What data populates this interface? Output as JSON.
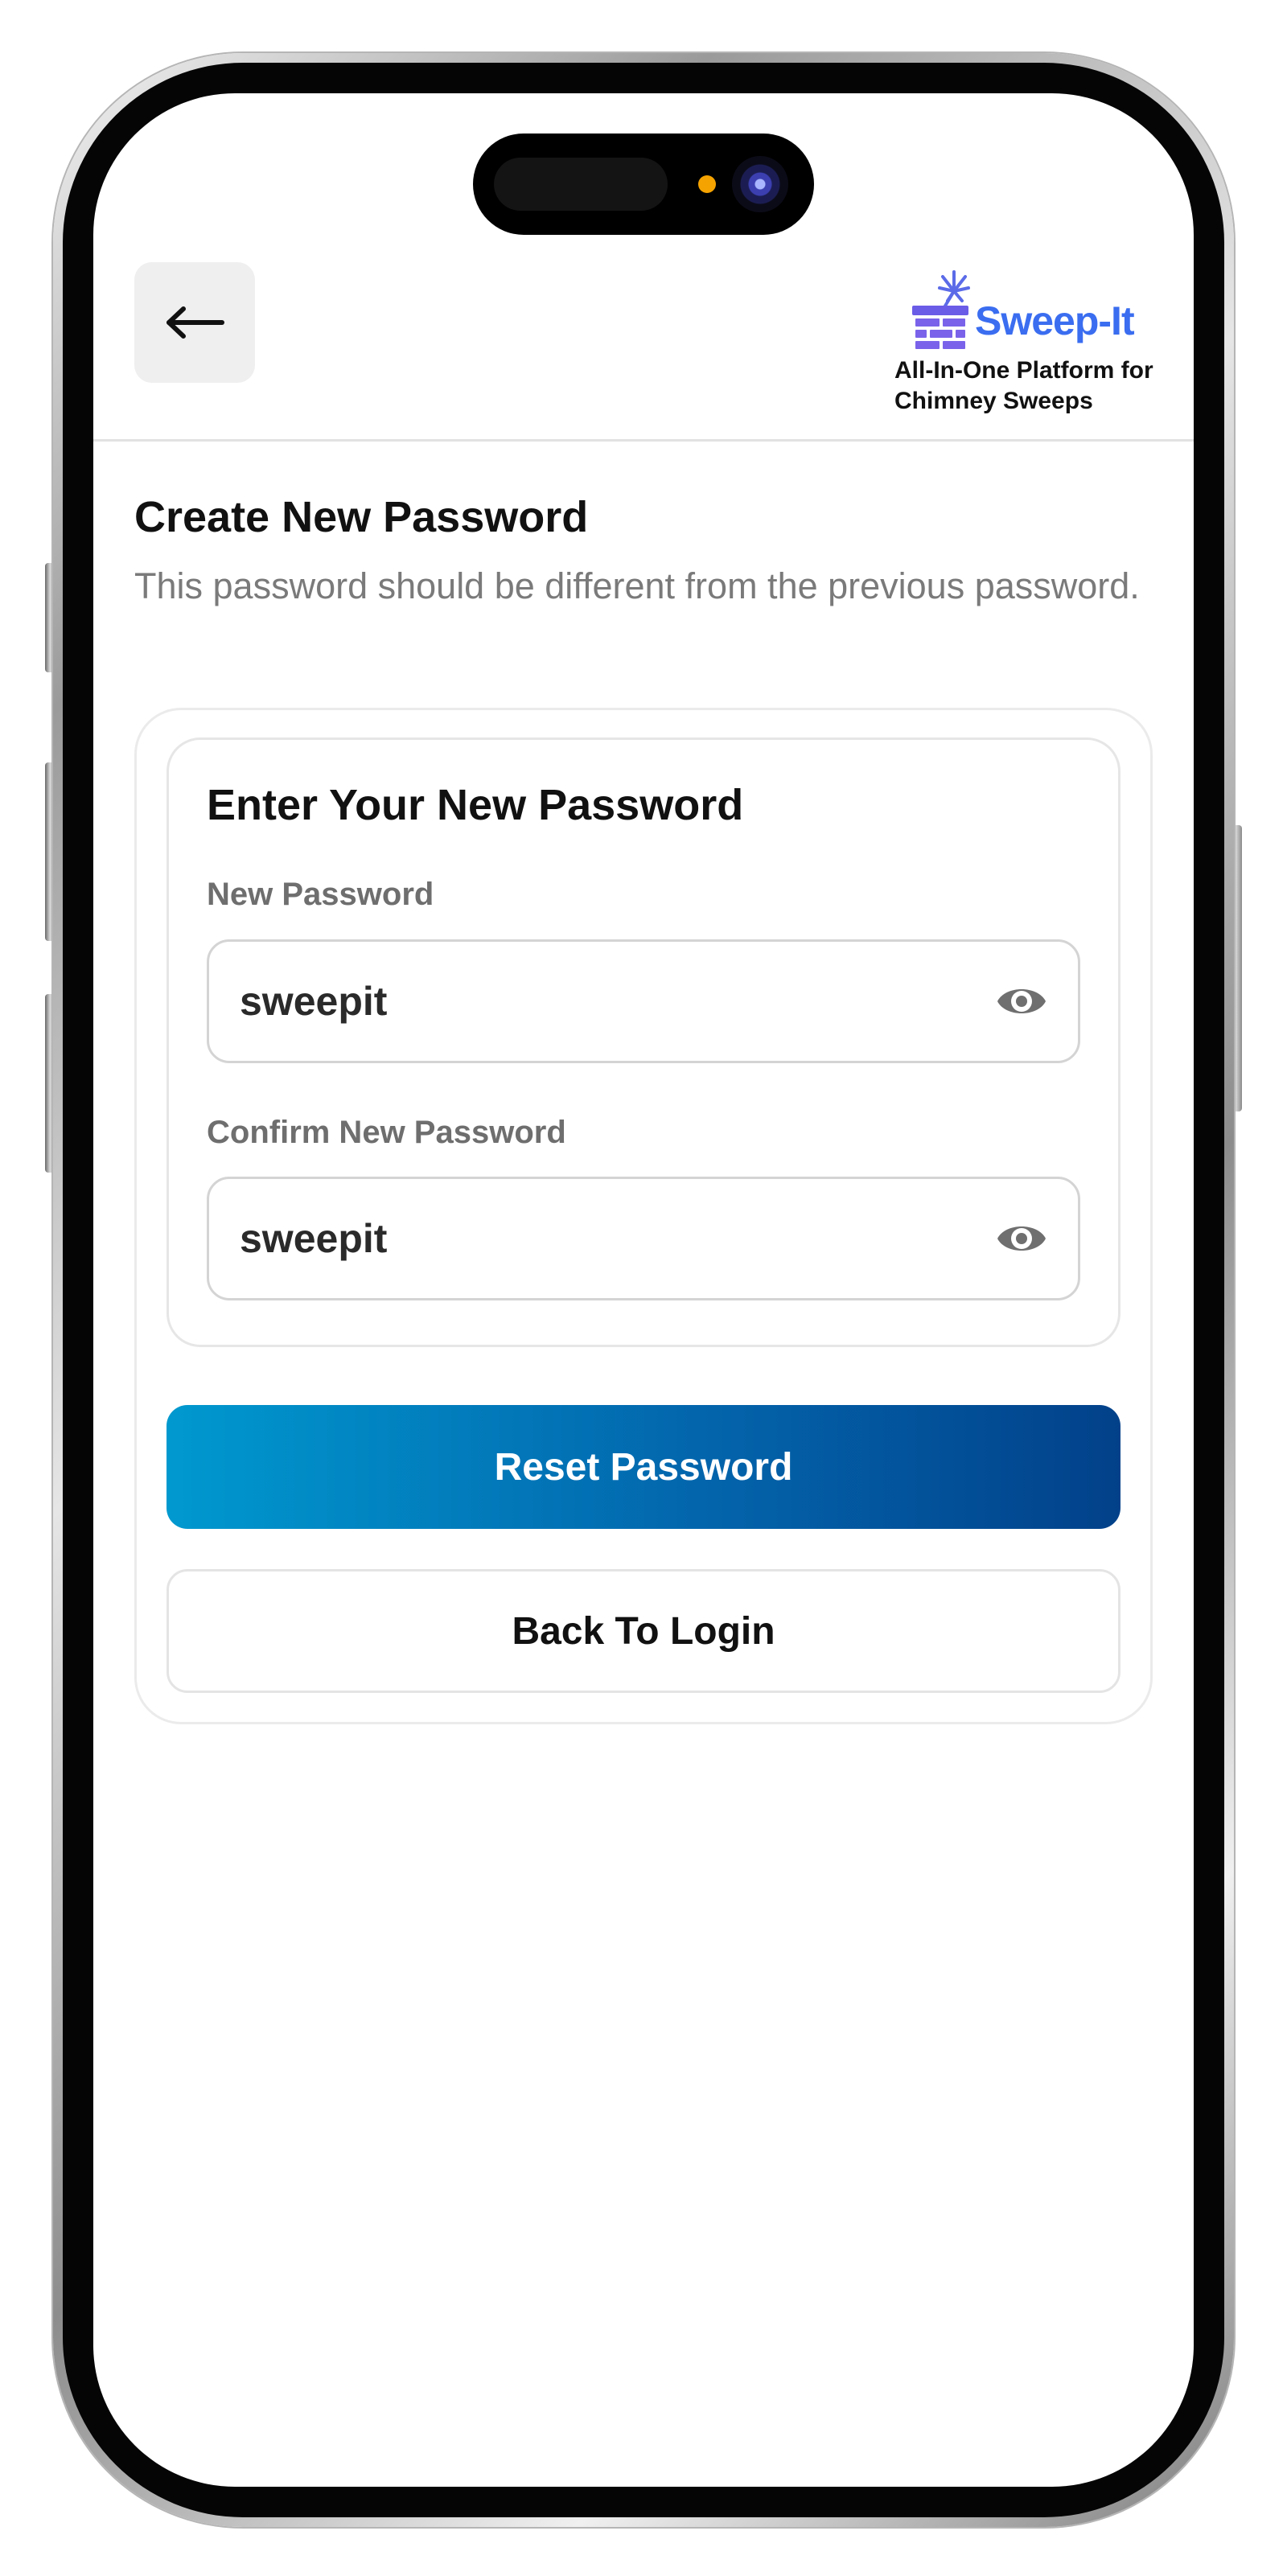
{
  "header": {
    "back_icon": "arrow-left-icon",
    "brand": {
      "name": "Sweep-It",
      "tagline": "All-In-One Platform for\nChimney Sweeps",
      "color": "#3a6df0",
      "mark_icon": "chimney-brush-icon"
    }
  },
  "page": {
    "title": "Create New Password",
    "subtitle": "This password should be different from the previous password."
  },
  "form": {
    "card_title": "Enter Your New Password",
    "new_password": {
      "label": "New Password",
      "value": "sweepit",
      "toggle_icon": "eye-icon"
    },
    "confirm_password": {
      "label": "Confirm New Password",
      "value": "sweepit",
      "toggle_icon": "eye-icon"
    },
    "reset_button": "Reset Password",
    "back_button": "Back To Login"
  },
  "colors": {
    "accent_gradient_start": "#0099cf",
    "accent_gradient_end": "#02418a",
    "brand": "#3a6df0",
    "camera_indicator": "#f5a300"
  }
}
